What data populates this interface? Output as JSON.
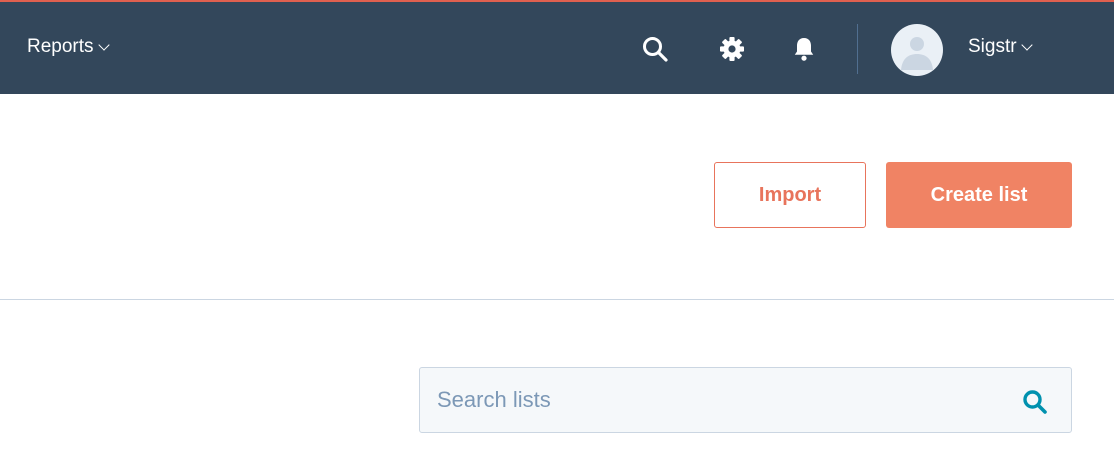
{
  "topbar": {
    "reports_label": "Reports",
    "search_icon": "search-icon",
    "settings_icon": "gear-icon",
    "notifications_icon": "bell-icon",
    "avatar_icon": "user-avatar-icon",
    "account_label": "Sigstr",
    "accent_color": "#e0604f",
    "background_color": "#33475b"
  },
  "actions": {
    "import_label": "Import",
    "create_label": "Create list",
    "primary_color": "#f08364"
  },
  "search": {
    "placeholder": "Search lists",
    "value": "",
    "icon": "search-icon"
  }
}
